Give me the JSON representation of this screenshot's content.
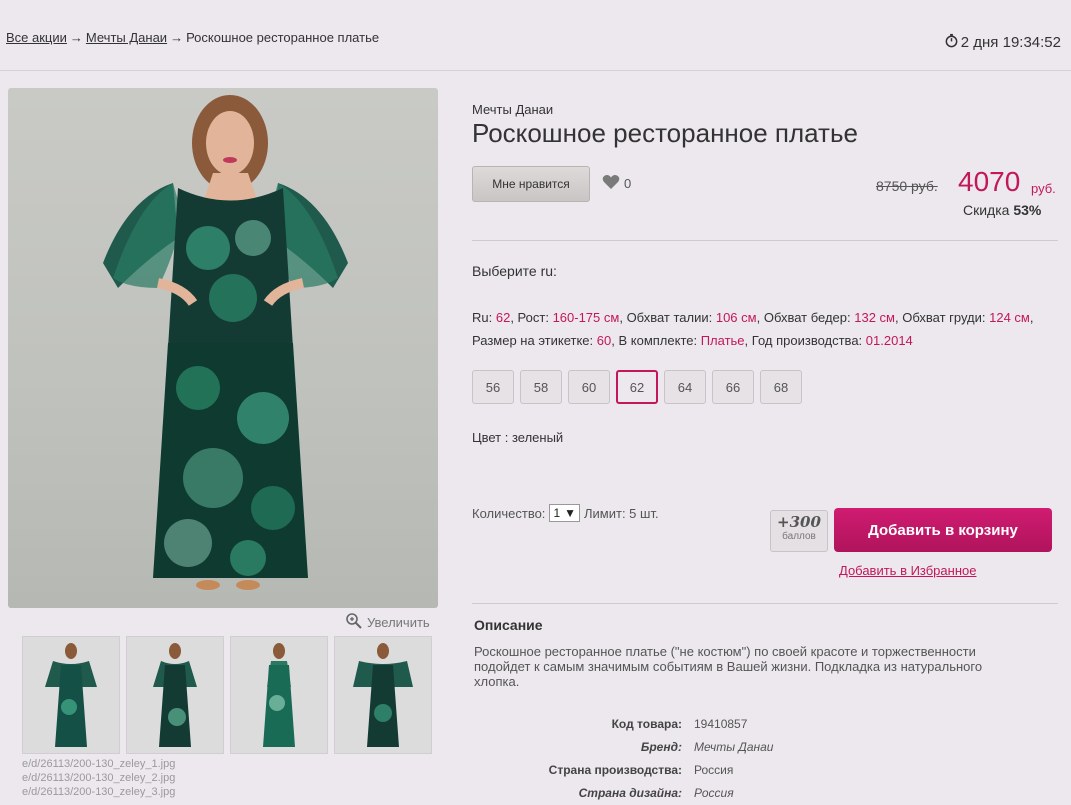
{
  "breadcrumb": {
    "items": [
      "Все акции",
      "Мечты Данаи",
      "Роскошное ресторанное платье"
    ],
    "separator": "→"
  },
  "timer": {
    "text": "2 дня 19:34:52"
  },
  "product": {
    "brand": "Мечты Данаи",
    "title": "Роскошное ресторанное платье",
    "like_label": "Мне нравится",
    "likes_count": "0",
    "old_price": "8750 руб.",
    "new_price": "4070",
    "currency": "руб.",
    "discount_label": "Скидка",
    "discount_value": "53%"
  },
  "size_picker": {
    "heading": "Выберите ru:",
    "params": [
      {
        "label": "Ru: ",
        "value": "62",
        "tail": ", "
      },
      {
        "label": "Рост: ",
        "value": "160-175 см",
        "tail": ", "
      },
      {
        "label": "Обхват талии: ",
        "value": "106 см",
        "tail": ", "
      },
      {
        "label": "Обхват бедер: ",
        "value": "132 см",
        "tail": ", "
      },
      {
        "label": "Обхват груди: ",
        "value": "124 см",
        "tail": ", "
      },
      {
        "label": "Размер на этикетке: ",
        "value": "60",
        "tail": ", "
      },
      {
        "label": "В комплекте: ",
        "value": "Платье",
        "tail": ", "
      },
      {
        "label": "Год производства: ",
        "value": "01.2014",
        "tail": ""
      }
    ],
    "sizes": [
      "56",
      "58",
      "60",
      "62",
      "64",
      "66",
      "68"
    ],
    "selected": "62"
  },
  "color_text": "Цвет : зеленый",
  "order": {
    "qty_label": "Количество:",
    "qty_value": "1",
    "limit_text": "Лимит: 5 шт.",
    "bonus_value": "+300",
    "bonus_label": "баллов",
    "cart_button": "Добавить в корзину",
    "favorite_link": "Добавить в Избранное"
  },
  "gallery": {
    "zoom_label": "Увеличить",
    "files": [
      "e/d/26113/200-130_zeley_1.jpg",
      "e/d/26113/200-130_zeley_2.jpg",
      "e/d/26113/200-130_zeley_3.jpg"
    ]
  },
  "description": {
    "heading": "Описание",
    "text": "Роскошное ресторанное платье (\"не костюм\") по своей красоте и торжественности подойдет к самым значимым событиям в Вашей жизни. Подкладка из натурального хлопка.",
    "specs": [
      {
        "key": "Код товара:",
        "value": "19410857"
      },
      {
        "key": "Бренд:",
        "value": "Мечты Данаи"
      },
      {
        "key": "Страна производства:",
        "value": "Россия"
      },
      {
        "key": "Страна дизайна:",
        "value": "Россия"
      }
    ]
  },
  "colors": {
    "accent": "#c2185b",
    "button": "#c81a68"
  }
}
